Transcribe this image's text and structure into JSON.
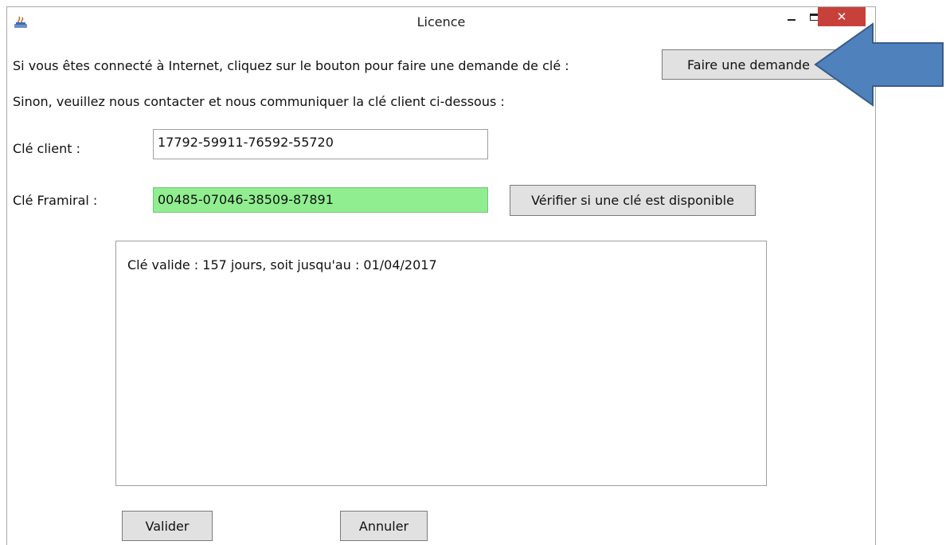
{
  "window": {
    "title": "Licence",
    "icon": "java-app-icon",
    "controls": [
      "minimize-icon",
      "maximize-icon",
      "close-icon"
    ]
  },
  "intro": {
    "online_text": "Si vous êtes connecté à Internet, cliquez sur le bouton pour faire une demande de clé :",
    "request_button": "Faire une demande",
    "offline_text": "Sinon, veuillez nous contacter et nous communiquer la clé client ci-dessous :"
  },
  "client_key": {
    "label": "Clé client :",
    "value": "17792-59911-76592-55720"
  },
  "framiral_key": {
    "label": "Clé Framiral :",
    "value": "00485-07046-38509-87891",
    "status_color": "#90ee90",
    "check_button": "Vérifier si une clé est disponible"
  },
  "result": {
    "message": "Clé valide :  157 jours, soit jusqu'au : 01/04/2017"
  },
  "footer": {
    "validate_button": "Valider",
    "cancel_button": "Annuler"
  },
  "annotation": {
    "arrow_color": "#4f81bd",
    "arrow_icon": "blue-arrow-left-icon"
  }
}
